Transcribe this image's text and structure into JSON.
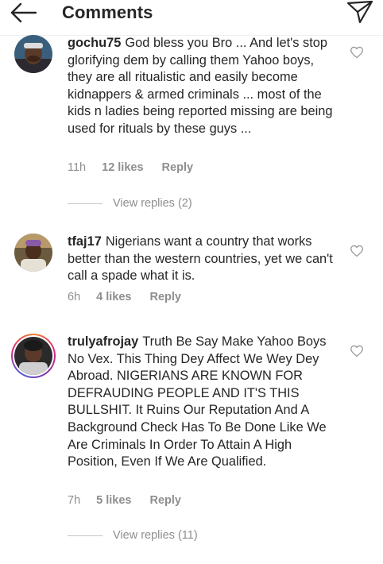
{
  "header": {
    "title": "Comments",
    "back_icon": "arrow-left-icon",
    "send_icon": "paper-plane-icon"
  },
  "comments": [
    {
      "username": "gochu75",
      "text": "God bless you Bro ... And let's stop glorifying dem by calling them Yahoo boys, they are all ritualistic and easily become kidnappers & armed criminals ... most of the kids n ladies being reported missing are being used for rituals by these guys ...",
      "time": "11h",
      "likes": "12 likes",
      "reply": "Reply",
      "view_replies": "View replies (2)"
    },
    {
      "username": "tfaj17",
      "text": "Nigerians want a country that works better than the western countries, yet we can't call a spade what it is.",
      "time": "6h",
      "likes": "4 likes",
      "reply": "Reply"
    },
    {
      "username": "trulyafrojay",
      "text": "Truth Be Say Make Yahoo Boys No Vex. This Thing Dey Affect We Wey Dey Abroad. NIGERIANS ARE KNOWN FOR DEFRAUDING PEOPLE AND IT'S THIS BULLSHIT. It Ruins Our Reputation And A Background Check Has To Be Done Like We Are Criminals In Order To Attain A High Position, Even If We Are Qualified.",
      "time": "7h",
      "likes": "5 likes",
      "reply": "Reply",
      "view_replies": "View replies (11)"
    }
  ],
  "colors": {
    "text": "#262626",
    "secondary": "#8e8e8e",
    "story_ring": "#dd2a7b"
  }
}
